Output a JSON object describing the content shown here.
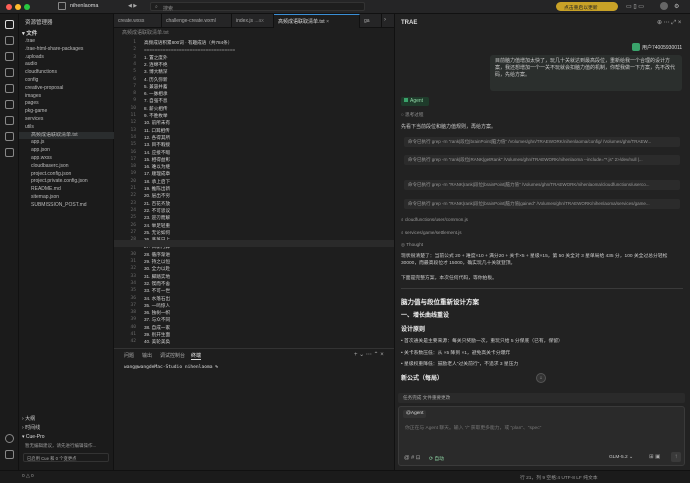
{
  "titlebar": {
    "project": "nihenlaoma",
    "branch_icon": "branch-icon",
    "search": "搜索",
    "update_btn": "点击重启以更新",
    "colors": {
      "close": "#ff5f57",
      "min": "#febc2e",
      "max": "#28c840"
    }
  },
  "sidebar": {
    "header": "资源管理器",
    "section": "文件",
    "items": [
      ".trae",
      ".trae-html-share-packages",
      ".uploads",
      "audio",
      "cloudfunctions",
      "config",
      "creative-proposal",
      "images",
      "pages",
      "pkg-game",
      "services",
      "utils",
      "高频成语联取清单.txt",
      "app.js",
      "app.json",
      "app.wxss",
      "cloudbaserc.json",
      "project.config.json",
      "project.private.config.json",
      "README.md",
      "sitemap.json",
      "SUBMISSION_POST.md"
    ],
    "outline": "大纲",
    "timeline": "时间线",
    "cue_pro": "Cue-Pro",
    "cue_msg": "暂无编辑建议，请先进行编辑操作...",
    "cue_status": "已启用 Cue 和 0 个变更点"
  },
  "tabs": [
    "create.wxss",
    "challenge-create.wxml",
    "index.js",
    "高频成语联取清单.txt",
    "ga"
  ],
  "tab_meta": "...ax",
  "breadcrumb": "高频成语联取清单.txt",
  "editor": {
    "lines": [
      "高频成语积累800词 · 有趣成语（共784条）",
      "==================================",
      "1. 置之度外",
      "2. 连绵不绝",
      "3. 博大精深",
      "4. 历久弥新",
      "5. 兼容并蓄",
      "6. 一脉相承",
      "7. 自强不息",
      "8. 薪火相传",
      "9. 不胜枚举",
      "10. 前所未有",
      "11. 口耳相传",
      "12. 各得其所",
      "13. 目不暇接",
      "14. 应接不暇",
      "15. 相得益彰",
      "16. 难以为继",
      "17. 顺理成章",
      "18. 承上启下",
      "19. 推陈出新",
      "20. 层出不穷",
      "21. 百花齐放",
      "22. 不可思议",
      "23. 迎刃而解",
      "24. 举足轻重",
      "25. 无论如何",
      "26. 蒸蒸日上",
      "27. 日新月异",
      "28. 循序渐进",
      "29. 持之以恒",
      "30. 全力以赴",
      "31. 脚踏实地",
      "32. 锲而不舍",
      "33. 不可一世",
      "34. 水落石出",
      "35. 一鸣惊人",
      "36. 独树一帜",
      "37. 与众不同",
      "38. 自成一家",
      "39. 别开生面",
      "40. 美轮美奂"
    ]
  },
  "terminal": {
    "tabs": [
      "问题",
      "输出",
      "调试控制台",
      "终端"
    ],
    "prompt": "wang@wangdeMac-Studio nihenlaoma %"
  },
  "agent": {
    "title": "TRAE",
    "user": "用户74005930011",
    "user_msg": "目前脑力值增加太快了，玩几十关就达到最高段位，重新给我一个合理的设计方案，我还想增加一个一关不玩就会扣脑力值的机制，你帮我做一下方案，先不改代码，先给方案。",
    "agent_label": "Agent",
    "thinking": "思考过程",
    "intro": "先看下当前段位和脑力值规则，再给方案。",
    "commands": [
      "命令已执行  grep -rn \"rank|段位|brainPoint|脑力值\" /Volumes/ghn/TRAEWORK/nihenlaoma/config/ /Volumes/ghn/TRAEW...",
      "命令已执行  grep -rn \"rank|段位|RANK|getRank\" /Volumes/ghn/TRAEWORK/nihenlaoma --include=\"*.js\" 2>/dev/null |...",
      "命令已执行  grep -rn \"RANK|rank|段位|brainPoint|脑力值\" /Volumes/ghn/TRAEWORK/nihenlaoma/cloudfunctions/userco...",
      "命令已执行  grep -rn \"RANK|rank|段位|brainPoint|脑力值|gained\" /Volumes/ghn/TRAEWORK/nihenlaoma/services/game..."
    ],
    "files": [
      "cloudfunctions/user/common.js",
      "services/game/settlement.js"
    ],
    "thought": "Thought",
    "summary": "现状很清楚了：当前公式 20 + 难度×10 + 满分20 + 关卡×5 + 星级×15，第 50 关全对 3 星单局给 435 分，100 关全过总分轻松 30000，而最高段位才 15000，确实玩几十关就登顶。",
    "next": "下面是完整方案，本次任何代码，等你拍板。",
    "h1": "脑力值与段位重新设计方案",
    "h2": "一、增长曲线重设",
    "h3": "设计原则",
    "bullets": [
      "首次通关是主要来源：每关只奖励一次，重玩只给 5 分保底（已有，保留）",
      "关卡系数压低：从 ×5 降到 ×1，避免高关卡分爆炸",
      "星级权重降低：鼓励老人\"过关前行\"，不追求 3 星压力"
    ],
    "h4": "新公式（每局）",
    "task_bar": "任务完成  文件重要更改",
    "input_label": "@Agent",
    "input_placeholder": "你正在与 Agent 聊天。输入 \"/\" 获取更多能力，或 \"plan\"、\"spec\"",
    "mode": "自动",
    "model": "GLM-5.2"
  },
  "status": {
    "left": "0 △ 0",
    "right": "行 21，列 9  空格:4  UTF-8  LF  纯文本"
  }
}
